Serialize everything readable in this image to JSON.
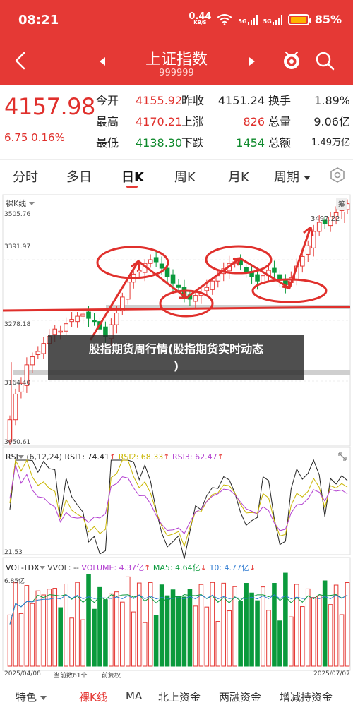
{
  "status": {
    "time": "08:21",
    "net_speed": "0.44",
    "net_unit": "KB/S",
    "sim1": "5G",
    "sim2": "5G",
    "battery": "85%",
    "battery_level": 0.85
  },
  "header": {
    "title": "上证指数",
    "code": "999999"
  },
  "quote": {
    "price": "4157.98",
    "change": "6.75  0.16%",
    "grid": [
      {
        "label": "今开",
        "value": "4155.92",
        "label2": "昨收",
        "value2": "4151.24",
        "label3": "换手",
        "value3": "1.89%"
      },
      {
        "label": "最高",
        "value": "4170.21",
        "label2": "上涨",
        "value2": "826",
        "label3": "总量",
        "value3": "9.06亿"
      },
      {
        "label": "最低",
        "value": "4138.30",
        "label2": "下跌",
        "value2": "1454",
        "label3": "总额",
        "value3": "1.49万亿"
      }
    ]
  },
  "tabs": [
    "分时",
    "多日",
    "日K",
    "周K",
    "月K",
    "周期"
  ],
  "active_tab": "日K",
  "kline": {
    "selector": "裸K线",
    "expand": "筹",
    "y_labels": [
      "3505.76",
      "3391.97",
      "3278.18",
      "3164.40",
      "3050.61"
    ],
    "high_label": "3497.22"
  },
  "rsi": {
    "name": "RSI",
    "params": "(6,12,24)",
    "rsi1": "RSI1: 74.41",
    "rsi2": "RSI2: 68.33",
    "rsi3": "RSI3: 62.47",
    "low_label": "21.53",
    "colors": {
      "rsi1": "#222222",
      "rsi2": "#c9b500",
      "rsi3": "#b23fd0"
    }
  },
  "vol": {
    "name": "VOL-TDX",
    "vvol": "VVOL: --",
    "volume": "VOLUME: 4.37亿",
    "ma5": "MA5: 4.64亿",
    "ma10": "10: 4.77亿",
    "top_label": "6.85亿",
    "date_start": "2025/04/08",
    "count": "当前数61个",
    "rights": "前复权",
    "date_end": "2025/07/07"
  },
  "watermark": {
    "line1": "股指期货周行情(股指期货实时动态",
    "line2": ")"
  },
  "bottom_tabs": [
    "特色",
    "裸K线",
    "MA",
    "北上资金",
    "两融资金",
    "增减持资金"
  ],
  "bottom_active": "裸K线",
  "chart_data": {
    "type": "candlestick",
    "ylim": [
      3050.61,
      3505.76
    ],
    "closes": [
      3092,
      3140,
      3160,
      3195,
      3210,
      3220,
      3235,
      3248,
      3262,
      3258,
      3272,
      3280,
      3286,
      3290,
      3282,
      3276,
      3262,
      3248,
      3270,
      3292,
      3322,
      3350,
      3365,
      3372,
      3385,
      3392,
      3388,
      3376,
      3360,
      3348,
      3340,
      3322,
      3318,
      3325,
      3330,
      3340,
      3352,
      3362,
      3375,
      3385,
      3388,
      3382,
      3370,
      3360,
      3352,
      3362,
      3372,
      3368,
      3355,
      3345,
      3358,
      3380,
      3398,
      3418,
      3445,
      3462,
      3460,
      3472,
      3480,
      3490,
      3497
    ]
  }
}
